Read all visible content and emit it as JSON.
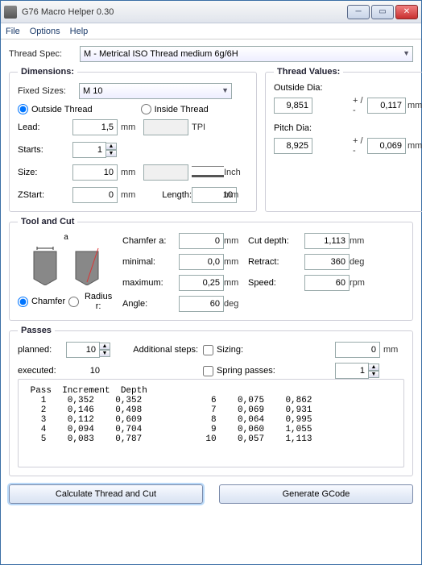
{
  "window": {
    "title": "G76 Macro Helper 0.30"
  },
  "menu": {
    "file": "File",
    "options": "Options",
    "help": "Help"
  },
  "threadspec": {
    "label": "Thread Spec:",
    "value": "M - Metrical ISO Thread medium 6g/6H"
  },
  "dimensions": {
    "legend": "Dimensions:",
    "fixed_sizes_label": "Fixed Sizes:",
    "fixed_sizes_value": "M 10",
    "outside_thread": "Outside Thread",
    "inside_thread": "Inside Thread",
    "lead_label": "Lead:",
    "lead_value": "1,5",
    "lead_unit": "mm",
    "tpi_label": "TPI",
    "tpi_value": "",
    "starts_label": "Starts:",
    "starts_value": "1",
    "size_label": "Size:",
    "size_value": "10",
    "size_unit": "mm",
    "inch_value": "",
    "inch_label": "Inch",
    "zstart_label": "ZStart:",
    "zstart_value": "0",
    "zstart_unit": "mm",
    "length_label": "Length:",
    "length_value": "10",
    "length_unit": "mm"
  },
  "thread_values": {
    "legend": "Thread Values:",
    "outside_dia_label": "Outside Dia:",
    "outside_dia": "9,851",
    "pm": "+ / -",
    "outside_tol": "0,117",
    "unit": "mm",
    "pitch_dia_label": "Pitch Dia:",
    "pitch_dia": "8,925",
    "pitch_tol": "0,069"
  },
  "tool": {
    "legend": "Tool and Cut",
    "a_label": "a",
    "chamfer_radio": "Chamfer",
    "radius_radio": "Radius r:",
    "chamfer_a_label": "Chamfer a:",
    "chamfer_a": "0",
    "chamfer_unit": "mm",
    "minimal_label": "minimal:",
    "minimal": "0,0",
    "maximum_label": "maximum:",
    "maximum": "0,25",
    "angle_label": "Angle:",
    "angle": "60",
    "angle_unit": "deg",
    "cut_depth_label": "Cut depth:",
    "cut_depth": "1,113",
    "cut_depth_unit": "mm",
    "retract_label": "Retract:",
    "retract": "360",
    "retract_unit": "deg",
    "speed_label": "Speed:",
    "speed": "60",
    "speed_unit": "rpm"
  },
  "passes": {
    "legend": "Passes",
    "planned_label": "planned:",
    "planned": "10",
    "executed_label": "executed:",
    "executed": "10",
    "addsteps_label": "Additional steps:",
    "sizing_label": "Sizing:",
    "sizing_val": "0",
    "sizing_unit": "mm",
    "spring_label": "Spring passes:",
    "spring_val": "1",
    "header": "Pass  Increment  Depth",
    "rows_left": [
      "   1    0,352    0,352",
      "   2    0,146    0,498",
      "   3    0,112    0,609",
      "   4    0,094    0,704",
      "   5    0,083    0,787"
    ],
    "rows_right": [
      " 6    0,075    0,862",
      " 7    0,069    0,931",
      " 8    0,064    0,995",
      " 9    0,060    1,055",
      "10    0,057    1,113"
    ]
  },
  "btns": {
    "calc": "Calculate Thread and Cut",
    "gcode": "Generate GCode"
  }
}
